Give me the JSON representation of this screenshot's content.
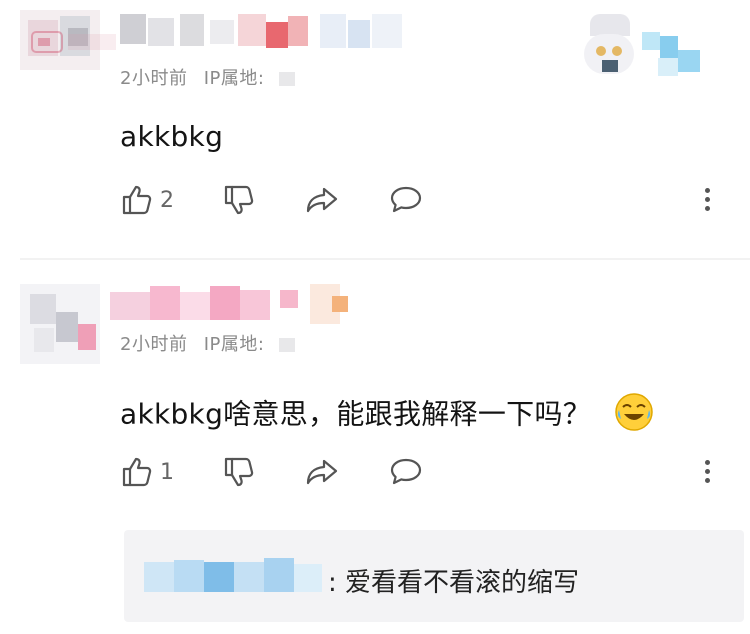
{
  "comments": [
    {
      "time": "2小时前",
      "ip_label": "IP属地:",
      "text": "akkbkg",
      "likes": "2"
    },
    {
      "time": "2小时前",
      "ip_label": "IP属地:",
      "text": "akkbkg啥意思，能跟我解释一下吗？",
      "likes": "1",
      "emoji": "laughing-crying-emoji",
      "reply": {
        "separator": ":",
        "text": "爱看看不看滚的缩写"
      }
    }
  ],
  "icons": {
    "like": "thumbs-up-icon",
    "dislike": "thumbs-down-icon",
    "share": "share-arrow-icon",
    "reply": "comment-bubble-icon",
    "more": "more-vertical-icon"
  },
  "colors": {
    "meta": "#8a8a8a",
    "icon": "#555555",
    "reply_bg": "#f3f3f5"
  }
}
